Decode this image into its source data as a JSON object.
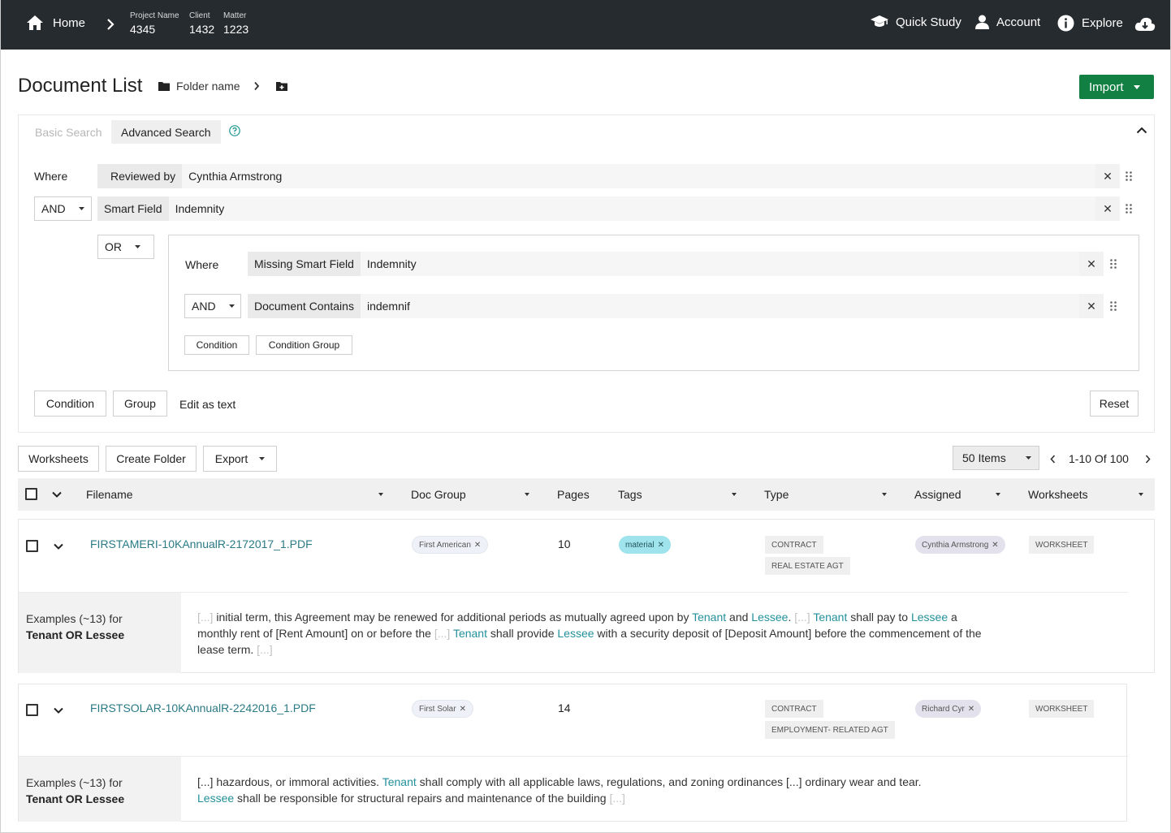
{
  "topbar": {
    "home_label": "Home",
    "project_name_key": "Project Name",
    "project_name_value": "4345",
    "client_key": "Client",
    "client_value": "1432",
    "matter_key": "Matter",
    "matter_value": "1223",
    "quick_study_label": "Quick Study",
    "account_label": "Account",
    "explore_label": "Explore"
  },
  "header": {
    "title": "Document List",
    "folder_name": "Folder name",
    "import_label": "Import"
  },
  "search": {
    "tab_basic": "Basic Search",
    "tab_advanced": "Advanced Search",
    "where_label": "Where",
    "conditions": [
      {
        "field": "Reviewed by",
        "value": "Cynthia Armstrong"
      },
      {
        "operator": "AND",
        "field": "Smart Field",
        "value": "Indemnity"
      }
    ],
    "group": {
      "operator": "OR",
      "where_label": "Where",
      "conditions": [
        {
          "field": "Missing Smart Field",
          "value": "Indemnity"
        },
        {
          "operator": "AND",
          "field": "Document Contains",
          "value": "indemnif"
        }
      ],
      "add_condition_label": "Condition",
      "add_group_label": "Condition Group"
    },
    "add_condition_label": "Condition",
    "add_group_label": "Group",
    "edit_as_text_label": "Edit as text",
    "reset_label": "Reset"
  },
  "toolbar": {
    "worksheets_label": "Worksheets",
    "create_folder_label": "Create Folder",
    "export_label": "Export",
    "items_per_page": "50 Items",
    "range_label": "1-10 Of 100"
  },
  "table": {
    "columns": [
      "Filename",
      "Doc Group",
      "Pages",
      "Tags",
      "Type",
      "Assigned",
      "Worksheets"
    ],
    "rows": [
      {
        "filename": "FIRSTAMERI-10KAnnualR-2172017_1.PDF",
        "doc_group": "First American",
        "pages": "10",
        "tag": "material",
        "types": [
          "CONTRACT",
          "REAL ESTATE AGT"
        ],
        "assigned": "Cynthia Armstrong",
        "worksheet": "WORKSHEET",
        "examples_label": "Examples (~13) for",
        "examples_query": "Tenant OR Lessee",
        "snippet": [
          {
            "t": "[...]",
            "k": "ell"
          },
          {
            "t": " initial term, this Agreement may be renewed for additional periods as mutually agreed upon by ",
            "k": ""
          },
          {
            "t": "Tenant",
            "k": "hl"
          },
          {
            "t": " and ",
            "k": ""
          },
          {
            "t": "Lessee",
            "k": "hl"
          },
          {
            "t": ". ",
            "k": ""
          },
          {
            "t": "[...]",
            "k": "ell"
          },
          {
            "t": " ",
            "k": ""
          },
          {
            "t": "Tenant",
            "k": "hl"
          },
          {
            "t": " shall pay to ",
            "k": ""
          },
          {
            "t": "Lessee",
            "k": "hl"
          },
          {
            "t": " a monthly rent of [Rent Amount] on or before the ",
            "k": ""
          },
          {
            "t": "[...]",
            "k": "ell"
          },
          {
            "t": " ",
            "k": ""
          },
          {
            "t": "Tenant",
            "k": "hl"
          },
          {
            "t": " shall provide ",
            "k": ""
          },
          {
            "t": "Lessee",
            "k": "hl"
          },
          {
            "t": " with a security deposit of [Deposit Amount] before the commencement of the lease term. ",
            "k": ""
          },
          {
            "t": "[...]",
            "k": "ell"
          }
        ]
      },
      {
        "filename": "FIRSTSOLAR-10KAnnualR-2242016_1.PDF",
        "doc_group": "First Solar",
        "pages": "14",
        "tag": "",
        "types": [
          "CONTRACT",
          "EMPLOYMENT- RELATED AGT"
        ],
        "assigned": "Richard Cyr",
        "worksheet": "WORKSHEET",
        "examples_label": "Examples (~13) for",
        "examples_query": "Tenant OR Lessee",
        "snippet": [
          {
            "t": "[...] hazardous, or immoral activities. ",
            "k": ""
          },
          {
            "t": "Tenant",
            "k": "hl"
          },
          {
            "t": " shall comply with all applicable laws, regulations, and zoning ordinances [...] ordinary wear and tear. ",
            "k": ""
          },
          {
            "t": "Lessee",
            "k": "hl"
          },
          {
            "t": " shall be responsible for structural repairs and maintenance of the building ",
            "k": ""
          },
          {
            "t": "[...]",
            "k": "ell"
          }
        ]
      }
    ]
  }
}
